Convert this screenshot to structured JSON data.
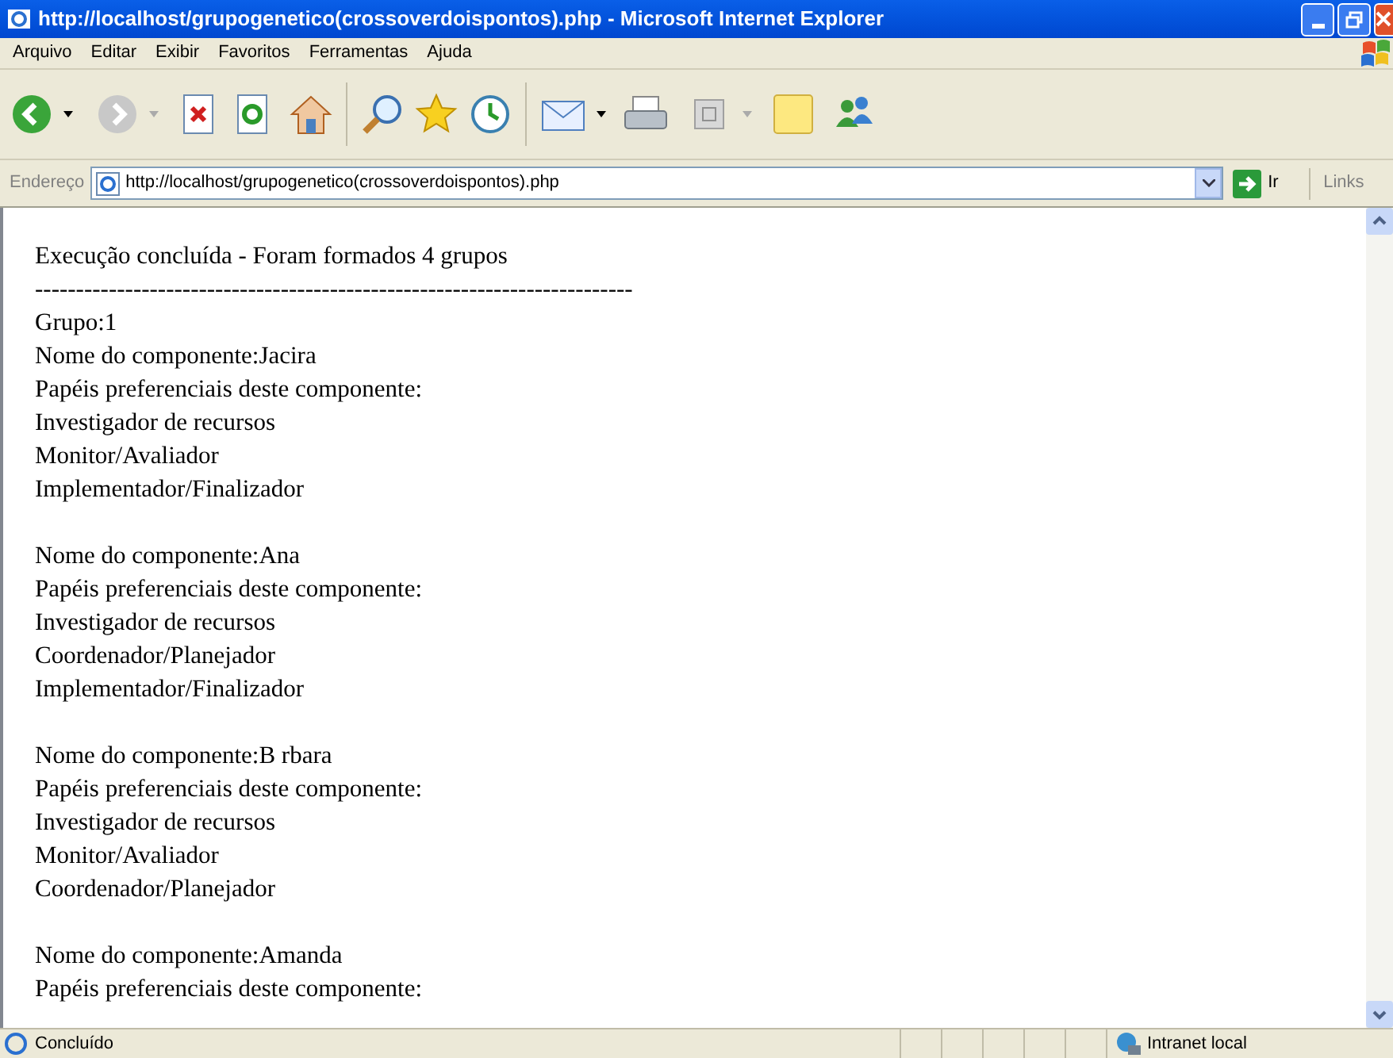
{
  "window": {
    "title": "http://localhost/grupogenetico(crossoverdoispontos).php - Microsoft Internet Explorer"
  },
  "menu": [
    "Arquivo",
    "Editar",
    "Exibir",
    "Favoritos",
    "Ferramentas",
    "Ajuda"
  ],
  "address_bar": {
    "label": "Endereço",
    "url": "http://localhost/grupogenetico(crossoverdoispontos).php",
    "go": "Ir",
    "links": "Links"
  },
  "page": {
    "paragraphs": [
      [
        "Execução concluída - Foram formados 4 grupos",
        "-------------------------------------------------------------------------",
        "Grupo:1",
        "Nome do componente:Jacira",
        "Papéis preferenciais deste componente:",
        "Investigador de recursos",
        "Monitor/Avaliador",
        "Implementador/Finalizador"
      ],
      [
        "Nome do componente:Ana",
        "Papéis preferenciais deste componente:",
        "Investigador de recursos",
        "Coordenador/Planejador",
        "Implementador/Finalizador"
      ],
      [
        "Nome do componente:B rbara",
        "Papéis preferenciais deste componente:",
        "Investigador de recursos",
        "Monitor/Avaliador",
        "Coordenador/Planejador"
      ],
      [
        "Nome do componente:Amanda",
        "Papéis preferenciais deste componente:"
      ]
    ]
  },
  "status_bar": {
    "text": "Concluído",
    "zone": "Intranet local"
  }
}
